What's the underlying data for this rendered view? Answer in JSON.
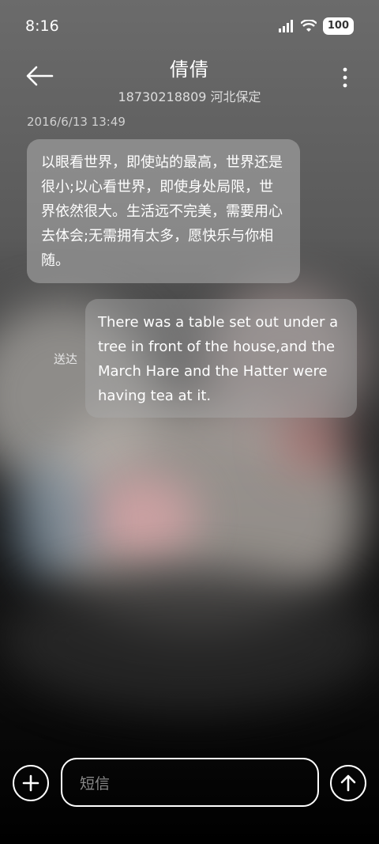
{
  "status_bar": {
    "time": "8:16",
    "battery": "100"
  },
  "header": {
    "title": "倩倩",
    "subtitle": "18730218809 河北保定"
  },
  "messages": [
    {
      "timestamp": "2016/6/13 13:49",
      "text": "以眼看世界，即使站的最高，世界还是很小;以心看世界，即使身处局限，世界依然很大。生活远不完美，需要用心去体会;无需拥有太多，愿快乐与你相随。"
    },
    {
      "status": "送达",
      "text": "There was a table set out under a tree in front of the house,and the March Hare and the Hatter were having tea at it."
    }
  ],
  "composer": {
    "placeholder": "短信"
  }
}
